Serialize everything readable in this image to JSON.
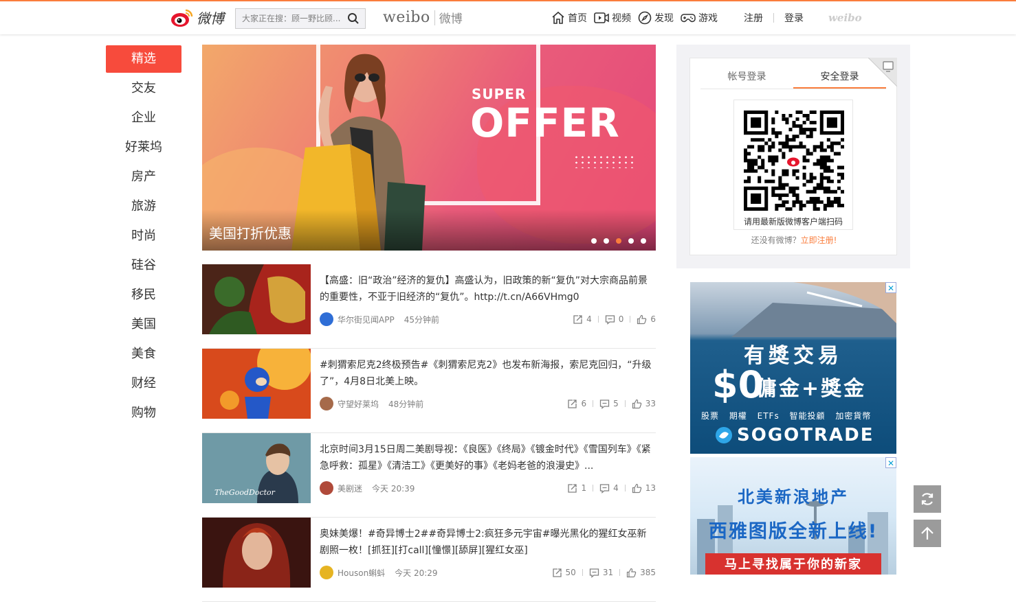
{
  "header": {
    "logo_text": "微博",
    "search_placeholder": "大家正在搜：顾一野比顾...",
    "brand_en": "weibo",
    "brand_cn": "微博",
    "nav": [
      {
        "label": "首页",
        "icon": "home-icon"
      },
      {
        "label": "视频",
        "icon": "video-icon"
      },
      {
        "label": "发现",
        "icon": "compass-icon"
      },
      {
        "label": "游戏",
        "icon": "gamepad-icon"
      }
    ],
    "register_label": "注册",
    "login_label": "登录",
    "weibo_mark": "weibo"
  },
  "sidebar": {
    "items": [
      "精选",
      "交友",
      "企业",
      "好莱坞",
      "房产",
      "旅游",
      "时尚",
      "硅谷",
      "移民",
      "美国",
      "美食",
      "财经",
      "购物"
    ],
    "active_index": 0
  },
  "banner": {
    "super_text": "SUPER",
    "offer_text": "OFFER",
    "caption": "美国打折优惠",
    "dot_count": 5,
    "active_dot": 2
  },
  "feed": [
    {
      "text": "【高盛：旧“政治”经济的复仇】高盛认为，旧政策的新“复仇”对大宗商品前景的重要性，不亚于旧经济的“复仇”。http://t.cn/A66VHmg0",
      "author": "华尔街见闻APP",
      "time": "45分钟前",
      "reposts": "4",
      "comments": "0",
      "likes": "6"
    },
    {
      "text": "#刺猬索尼克2终极预告#《刺猬索尼克2》也发布新海报，索尼克回归，“升级了”，4月8日北美上映。",
      "author": "守望好莱坞",
      "time": "48分钟前",
      "reposts": "6",
      "comments": "5",
      "likes": "33"
    },
    {
      "text": "北京时间3月15日周二美剧导视：《良医》《终局》《镀金时代》《雪国列车》《紧急呼救：孤星》《清洁工》《更美好的事》《老妈老爸的浪漫史》...",
      "author": "美剧迷",
      "time": "今天 20:39",
      "reposts": "1",
      "comments": "4",
      "likes": "13",
      "thumb_label": "TheGoodDoctor"
    },
    {
      "text": "奥妹美爆！#奇异博士2##奇异博士2:疯狂多元宇宙#曝光黑化的猩红女巫新剧照一枚！[抓狂][打call][憧憬][舔屏][猩红女巫]",
      "author": "Houson蝌蚪",
      "time": "今天 20:29",
      "reposts": "50",
      "comments": "31",
      "likes": "385"
    }
  ],
  "login": {
    "tab_account": "帐号登录",
    "tab_secure": "安全登录",
    "qr_caption": "请用最新版微博客户端扫码",
    "no_account": "还没有微博？",
    "register_now": "立即注册!"
  },
  "ads": {
    "close_label": "✕",
    "ad1_title": "有獎交易",
    "ad1_money": "$0",
    "ad1_sub": "傭金+獎金",
    "ad1_tags": "股票 期權 ETFs 智能投顧 加密貨幣",
    "ad1_brand": "SOGOTRADE",
    "ad2_line1": "北美新浪地产",
    "ad2_line2": "西雅图版全新上线!",
    "ad2_banner": "马上寻找属于你的新家"
  },
  "colors": {
    "accent": "#fa7d3c",
    "active_tab": "#f74b3c",
    "link": "#fa7d3c"
  }
}
